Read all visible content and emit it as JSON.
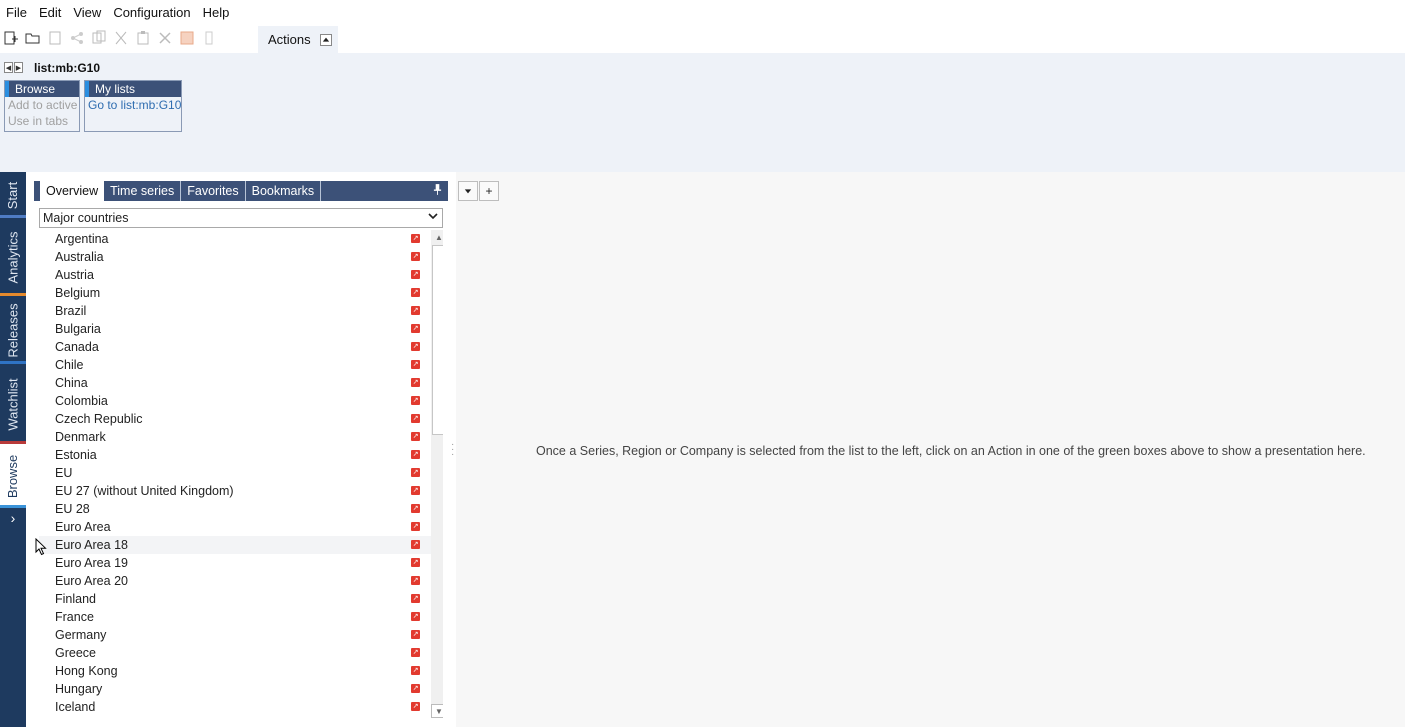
{
  "menu": [
    "File",
    "Edit",
    "View",
    "Configuration",
    "Help"
  ],
  "toolbar": {
    "icons": [
      "new-icon",
      "open-icon",
      "print-icon",
      "share-icon",
      "copy-icon",
      "cut-icon",
      "paste-icon",
      "delete-icon",
      "image-icon",
      "misc-icon"
    ],
    "actions_label": "Actions"
  },
  "ribbon": {
    "title": "list:mb:G10",
    "browse": {
      "header": "Browse",
      "items": [
        "Add to active",
        "Use in tabs"
      ]
    },
    "mylists": {
      "header": "My lists",
      "items": [
        "Go to list:mb:G10"
      ]
    }
  },
  "vtabs": [
    {
      "label": "Start",
      "color": "#4f7cc4"
    },
    {
      "label": "Analytics",
      "color": "#e58a2d"
    },
    {
      "label": "Releases",
      "color": "#2f73c4"
    },
    {
      "label": "Watchlist",
      "color": "#b83a3a"
    },
    {
      "label": "Browse",
      "color": "#3a93d9"
    }
  ],
  "panel": {
    "tabs": [
      "Overview",
      "Time series",
      "Favorites",
      "Bookmarks"
    ],
    "select_value": "Major countries",
    "items": [
      "Argentina",
      "Australia",
      "Austria",
      "Belgium",
      "Brazil",
      "Bulgaria",
      "Canada",
      "Chile",
      "China",
      "Colombia",
      "Czech Republic",
      "Denmark",
      "Estonia",
      "EU",
      "EU 27 (without United Kingdom)",
      "EU 28",
      "Euro Area",
      "Euro Area 18",
      "Euro Area 19",
      "Euro Area 20",
      "Finland",
      "France",
      "Germany",
      "Greece",
      "Hong Kong",
      "Hungary",
      "Iceland"
    ]
  },
  "main": {
    "message": "Once a Series, Region or Company is selected from the list to the left, click on an Action in one of the green boxes above to show a presentation here."
  }
}
